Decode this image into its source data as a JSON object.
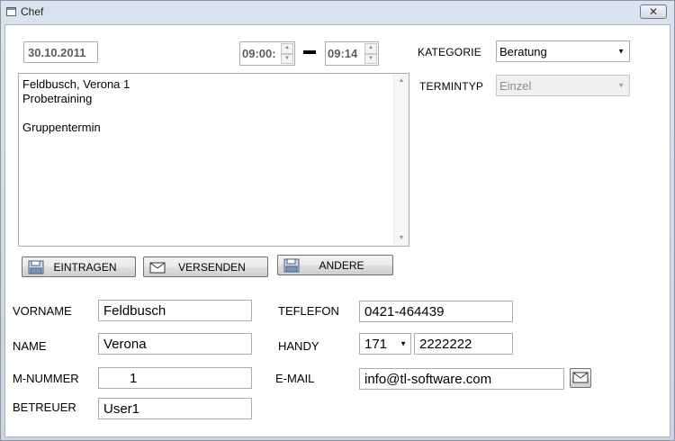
{
  "window": {
    "title": "Chef",
    "close_glyph": "✕"
  },
  "appointment": {
    "date": "30.10.2011",
    "start_time": "09:00:",
    "end_time": "09:14",
    "notes": [
      "Feldbusch, Verona 1",
      "Probetraining",
      "",
      "Gruppentermin"
    ]
  },
  "category": {
    "label": "KATEGORIE",
    "value": "Beratung"
  },
  "termintyp": {
    "label": "TERMINTYP",
    "value": "Einzel"
  },
  "buttons": {
    "eintragen": "EINTRAGEN",
    "versenden": "VERSENDEN",
    "andere": "ANDERE"
  },
  "person": {
    "vorname_label": "VORNAME",
    "vorname": "Feldbusch",
    "name_label": "NAME",
    "name": "Verona",
    "mnummer_label": "M-NUMMER",
    "mnummer": "1",
    "betreuer_label": "BETREUER",
    "betreuer": "User1"
  },
  "contact": {
    "telefon_label": "TEFLEFON",
    "telefon": "0421-464439",
    "handy_label": "HANDY",
    "handy_prefix": "171",
    "handy_number": "2222222",
    "email_label": "E-MAIL",
    "email": "info@tl-software.com"
  },
  "icons": {
    "button_icon_1": "floppy-disk-icon",
    "button_icon_2": "envelope-icon",
    "button_icon_3": "floppy-disk-icon",
    "email_icon": "envelope-icon"
  }
}
